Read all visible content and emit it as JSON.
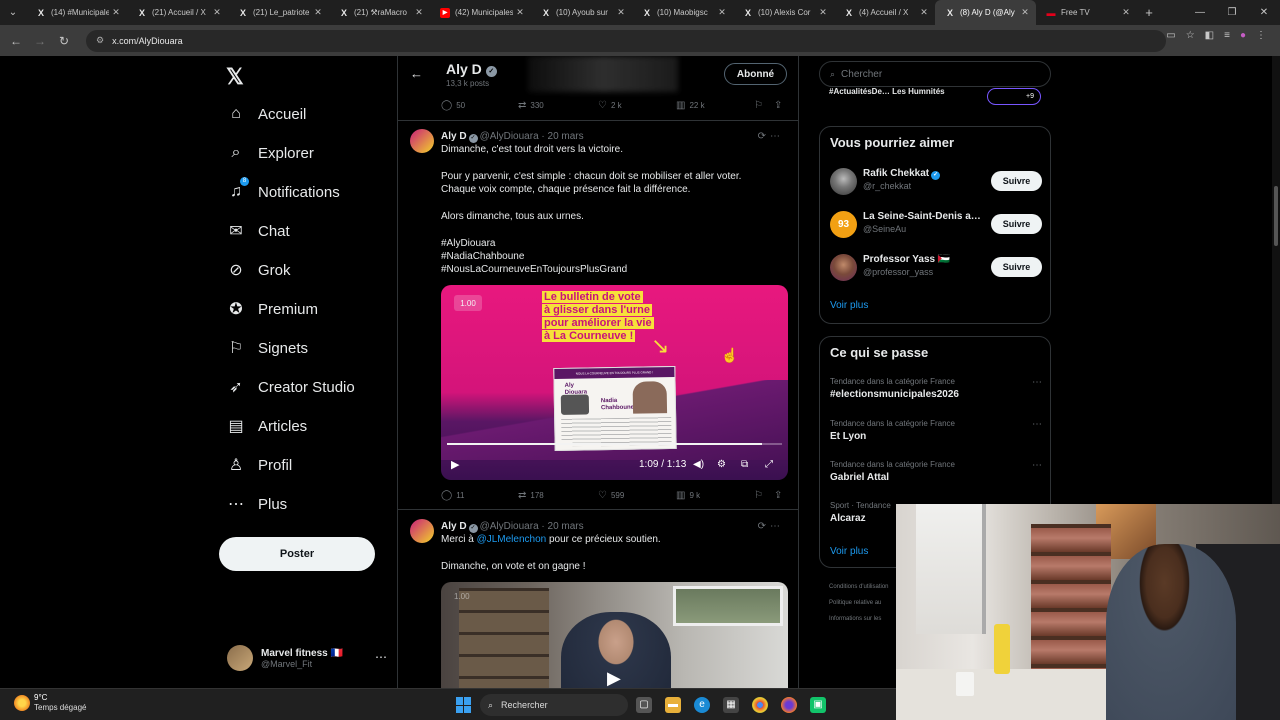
{
  "browser": {
    "tabs": [
      {
        "label": "(14) #Municipales",
        "icon": "x-logo-icon"
      },
      {
        "label": "(21) Accueil / X",
        "icon": "x-logo-icon"
      },
      {
        "label": "(21) Le_patriote",
        "icon": "x-logo-icon"
      },
      {
        "label": "(21) ⚒raMacro",
        "icon": "x-logo-icon"
      },
      {
        "label": "(42) Municipales",
        "icon": "youtube-icon"
      },
      {
        "label": "(10) Ayoub sur",
        "icon": "x-logo-icon"
      },
      {
        "label": "(10) Maobigsc",
        "icon": "x-logo-icon"
      },
      {
        "label": "(10) Alexis Cor",
        "icon": "x-logo-icon"
      },
      {
        "label": "(4) Accueil / X",
        "icon": "x-logo-icon"
      },
      {
        "label": "(8) Aly D (@Aly",
        "icon": "x-logo-icon",
        "active": true
      },
      {
        "label": "Free TV",
        "icon": "freetv-icon"
      }
    ],
    "url": "x.com/AlyDiouara"
  },
  "sidebar": {
    "items": [
      {
        "label": "Accueil",
        "icon": "home-icon"
      },
      {
        "label": "Explorer",
        "icon": "search-icon"
      },
      {
        "label": "Notifications",
        "icon": "bell-icon",
        "badge": "8"
      },
      {
        "label": "Chat",
        "icon": "mail-icon"
      },
      {
        "label": "Grok",
        "icon": "grok-icon"
      },
      {
        "label": "Premium",
        "icon": "premium-icon"
      },
      {
        "label": "Signets",
        "icon": "bookmark-icon"
      },
      {
        "label": "Creator Studio",
        "icon": "rocket-icon"
      },
      {
        "label": "Articles",
        "icon": "article-icon"
      },
      {
        "label": "Profil",
        "icon": "person-icon"
      },
      {
        "label": "Plus",
        "icon": "more-circle-icon"
      }
    ],
    "post_label": "Poster",
    "account": {
      "name": "Marvel fitness 🇫🇷",
      "handle": "@Marvel_Fit"
    }
  },
  "profile_header": {
    "name": "Aly D",
    "post_count": "13,3 k posts",
    "subscribe_label": "Abonné"
  },
  "top_actions": {
    "replies": "50",
    "reposts": "330",
    "likes": "2 k",
    "views": "22 k"
  },
  "tweet1": {
    "name": "Aly D",
    "handle": "@AlyDiouara",
    "time": "20 mars",
    "line1": "Dimanche, c'est tout droit vers la victoire.",
    "line2": "Pour y parvenir, c'est simple : chacun doit se mobiliser et aller voter.",
    "line3": "Chaque voix compte, chaque présence fait la différence.",
    "line4": "Alors dimanche, tous aux urnes.",
    "hashtags": [
      "#AlyDiouara",
      "#NadiaChahboune",
      "#NousLaCourneuveEnToujoursPlusGrand"
    ],
    "video": {
      "speed": "1.00",
      "headline": [
        "Le bulletin de vote",
        "à glisser dans l'urne",
        "pour améliorer la vie",
        "à La Courneuve !"
      ],
      "flyer_top": "NOUS LA COURNEUVE EN TOUJOURS PLUS GRAND !",
      "flyer_name1": "Aly",
      "flyer_name2": "Diouara",
      "flyer_name3": "Nadia",
      "flyer_name4": "Chahboune",
      "time": "1:09 / 1:13",
      "progress": 0.94
    },
    "actions": {
      "replies": "11",
      "reposts": "178",
      "likes": "599",
      "views": "9 k"
    }
  },
  "tweet2": {
    "name": "Aly D",
    "handle": "@AlyDiouara",
    "time": "20 mars",
    "text_before": "Merci à ",
    "mention": "@JLMelenchon",
    "text_after": " pour ce précieux soutien.",
    "line2": "Dimanche, on vote et on gagne !",
    "video_speed": "1.00"
  },
  "right": {
    "search_placeholder": "Chercher",
    "top_cut_text": "#ActualitésDe… Les Humnités",
    "top_cut_badge": "+9",
    "suggest_title": "Vous pourriez aimer",
    "suggestions": [
      {
        "name": "Rafik Chekkat",
        "handle": "@r_chekkat",
        "verified": true,
        "follow": "Suivre"
      },
      {
        "name": "La Seine-Saint-Denis a…",
        "handle": "@SeineAu",
        "verified": false,
        "follow": "Suivre",
        "avatar_text": "93"
      },
      {
        "name": "Professor Yass 🇵🇸",
        "handle": "@professor_yass",
        "verified": false,
        "follow": "Suivre"
      }
    ],
    "suggest_more": "Voir plus",
    "trends_title": "Ce qui se passe",
    "trends": [
      {
        "category": "Tendance dans la catégorie France",
        "title": "#electionsmunicipales2026"
      },
      {
        "category": "Tendance dans la catégorie France",
        "title": "Et Lyon"
      },
      {
        "category": "Tendance dans la catégorie France",
        "title": "Gabriel Attal"
      },
      {
        "category": "Sport · Tendance",
        "title": "Alcaraz"
      }
    ],
    "trends_more": "Voir plus",
    "footer": [
      "Conditions d'utilisation",
      "Politique relative au",
      "Informations sur les"
    ]
  },
  "taskbar": {
    "temp": "9°C",
    "weather": "Temps dégagé",
    "search": "Rechercher"
  },
  "colors": {
    "accent": "#1d9bf0",
    "video_pink": "#e8187e",
    "video_yellow": "#f7e03a"
  }
}
